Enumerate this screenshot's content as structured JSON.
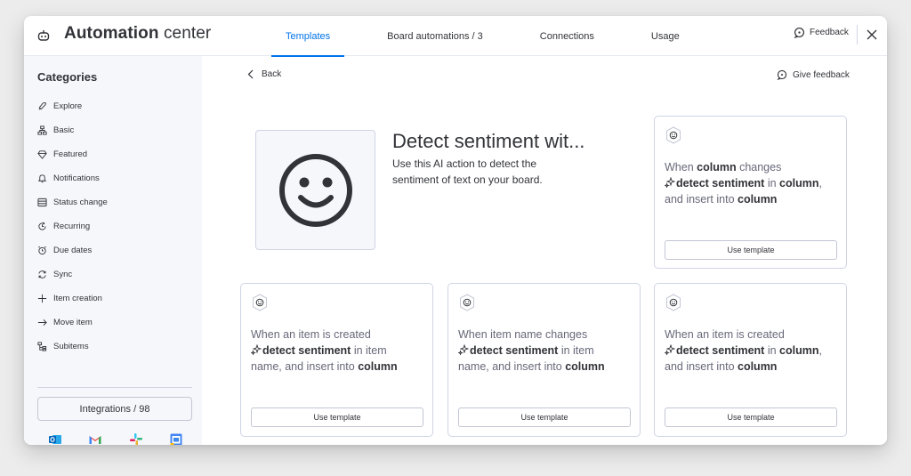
{
  "header": {
    "title_bold": "Automation",
    "title_light": "center",
    "tabs": [
      {
        "label": "Templates",
        "active": true
      },
      {
        "label": "Board automations / 3",
        "active": false
      },
      {
        "label": "Connections",
        "active": false
      },
      {
        "label": "Usage",
        "active": false
      }
    ],
    "feedback_label": "Feedback",
    "accent_color": "#0073ea"
  },
  "sidebar": {
    "title": "Categories",
    "items": [
      {
        "label": "Explore",
        "icon": "rocket-icon"
      },
      {
        "label": "Basic",
        "icon": "sitemap-icon"
      },
      {
        "label": "Featured",
        "icon": "diamond-icon"
      },
      {
        "label": "Notifications",
        "icon": "bell-icon"
      },
      {
        "label": "Status change",
        "icon": "status-icon"
      },
      {
        "label": "Recurring",
        "icon": "recurring-icon"
      },
      {
        "label": "Due dates",
        "icon": "alarm-icon"
      },
      {
        "label": "Sync",
        "icon": "sync-icon"
      },
      {
        "label": "Item creation",
        "icon": "plus-icon"
      },
      {
        "label": "Move item",
        "icon": "arrow-right-icon"
      },
      {
        "label": "Subitems",
        "icon": "subitems-icon"
      }
    ],
    "integrations_label": "Integrations / 98",
    "integration_icons": [
      "outlook-icon",
      "gmail-icon",
      "slack-icon",
      "google-calendar-icon"
    ]
  },
  "main": {
    "back_label": "Back",
    "give_feedback_label": "Give feedback",
    "hero": {
      "title": "Detect sentiment wit...",
      "description": "Use this AI action to detect the sentiment of text on your board.",
      "image_icon": "smiley-icon"
    },
    "cards": [
      {
        "line1_pre": "When ",
        "line1_bold": "column",
        "line1_post": " changes",
        "line2_bold": "detect sentiment",
        "line2_mid": " in ",
        "line2_bold2": "column",
        "line2_post": ",",
        "line3_pre": "and insert into ",
        "line3_bold": "column",
        "button": "Use template"
      },
      {
        "line1_pre": "When an item is created",
        "line1_bold": "",
        "line1_post": "",
        "line2_bold": "detect sentiment",
        "line2_mid": " in item",
        "line2_bold2": "",
        "line2_post": "",
        "line3_pre": "name, and insert into ",
        "line3_bold": "column",
        "button": "Use template"
      },
      {
        "line1_pre": "When item name changes",
        "line1_bold": "",
        "line1_post": "",
        "line2_bold": "detect sentiment",
        "line2_mid": " in item",
        "line2_bold2": "",
        "line2_post": "",
        "line3_pre": "name, and insert into ",
        "line3_bold": "column",
        "button": "Use template"
      },
      {
        "line1_pre": "When an item is created",
        "line1_bold": "",
        "line1_post": "",
        "line2_bold": "detect sentiment",
        "line2_mid": " in ",
        "line2_bold2": "column",
        "line2_post": ",",
        "line3_pre": "and insert into ",
        "line3_bold": "column",
        "button": "Use template"
      }
    ]
  }
}
